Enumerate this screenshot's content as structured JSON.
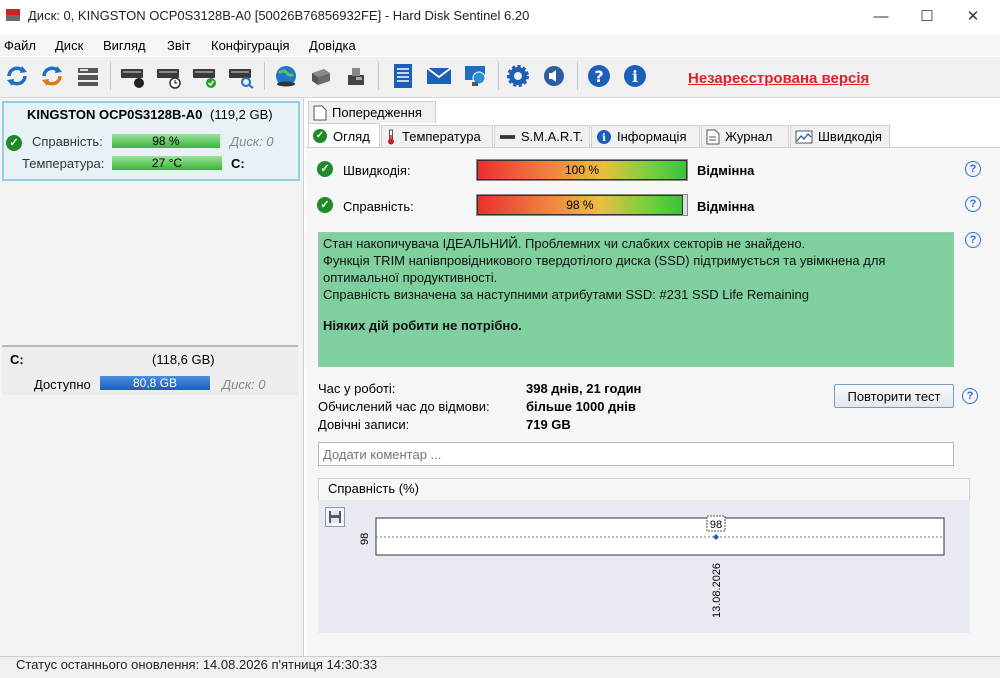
{
  "window": {
    "title": "Диск: 0, KINGSTON OCP0S3128B-A0 [50026B76856932FE]  -  Hard Disk Sentinel 6.20",
    "minimize": "—",
    "maximize": "☐",
    "close": "✕"
  },
  "menu": [
    "Файл",
    "Диск",
    "Вигляд",
    "Звіт",
    "Конфігурація",
    "Довідка"
  ],
  "toolbar": {
    "unregistered": "Незареєстрована версія"
  },
  "disk": {
    "name": "KINGSTON OCP0S3128B-A0",
    "size": "(119,2 GB)",
    "health_label": "Справність:",
    "health_value": "98 %",
    "health_percent": 98,
    "disk_index": "Диск: 0",
    "temp_label": "Температура:",
    "temp_value": "27 °C",
    "temp_percent": 100,
    "partition_letter": "C:"
  },
  "volume": {
    "letter": "C:",
    "size": "(118,6 GB)",
    "free_label": "Доступно",
    "free_value": "80,8 GB",
    "free_percent": 100,
    "disk_index": "Диск: 0"
  },
  "tabs": {
    "warnings": "Попередження",
    "items": [
      "Огляд",
      "Температура",
      "S.M.A.R.T.",
      "Інформація",
      "Журнал",
      "Швидкодія"
    ]
  },
  "overview": {
    "performance_label": "Швидкодія:",
    "performance_value": "100 %",
    "performance_percent": 100,
    "performance_rating": "Відмінна",
    "health_label": "Справність:",
    "health_value": "98 %",
    "health_percent": 98,
    "health_rating": "Відмінна",
    "status_lines": [
      "Стан накопичувача ІДЕАЛЬНИЙ. Проблемних чи слабких секторів не знайдено.",
      "Функція TRIM напівпровідникового твердотілого диска (SSD) підтримується та увімкнена для оптимальної продуктивності.",
      "Справність визначена за наступними атрибутами SSD:  #231 SSD Life Remaining"
    ],
    "status_action": "Ніяких дій робити не потрібно.",
    "uptime_label": "Час у роботі:",
    "uptime_value": "398 днів, 21 годин",
    "ttf_label": "Обчислений час до відмови:",
    "ttf_value": "більше 1000 днів",
    "writes_label": "Довічні записи:",
    "writes_value": "719 GB",
    "retest_button": "Повторити тест",
    "comment_placeholder": "Додати коментар ..."
  },
  "chart_data": {
    "type": "line",
    "title": "Справність (%)",
    "x": [
      "13.08.2026"
    ],
    "series": [
      {
        "values": [
          98
        ]
      }
    ],
    "y_tick_labels": [
      "98"
    ],
    "data_labels": [
      "98"
    ]
  },
  "statusbar": {
    "text": "Статус останнього оновлення: 14.08.2026 п'ятниця 14:30:33"
  }
}
